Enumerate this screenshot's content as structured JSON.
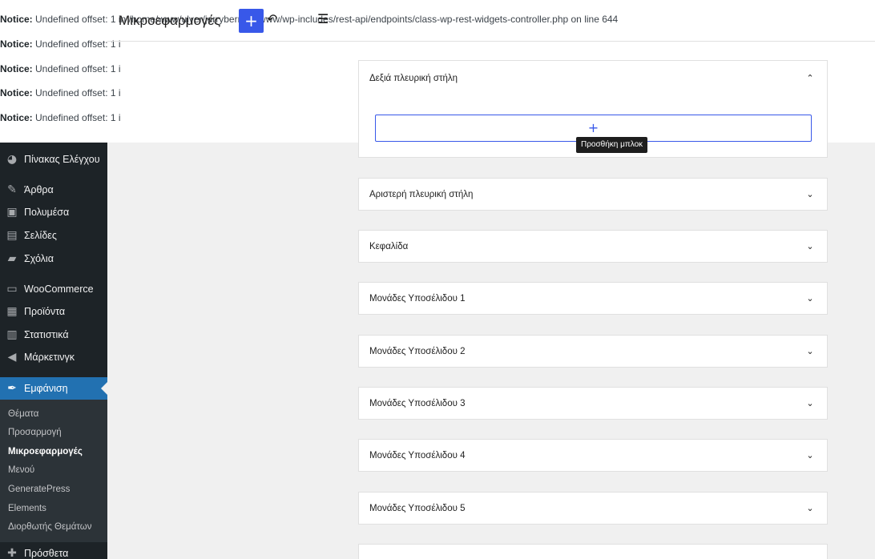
{
  "notices": {
    "label": "Notice:",
    "lines": [
      "Undefined offset: 1 in /home/www/ulver/jerryberry.gr/www/wp-includes/rest-api/endpoints/class-wp-rest-widgets-controller.php on line 644",
      "Undefined offset: 1 i",
      "Undefined offset: 1 i",
      "Undefined offset: 1 i",
      "Undefined offset: 1 i"
    ]
  },
  "header": {
    "title": "Μικροεφαρμογές",
    "inserter": "+",
    "undo_icon": "undo-icon",
    "list_icon": "list-view-icon"
  },
  "sidebar": {
    "items": [
      {
        "label": "Πίνακας Ελέγχου",
        "icon": "dashboard-icon"
      },
      {
        "label": "Άρθρα",
        "icon": "pin-icon"
      },
      {
        "label": "Πολυμέσα",
        "icon": "media-icon"
      },
      {
        "label": "Σελίδες",
        "icon": "pages-icon"
      },
      {
        "label": "Σχόλια",
        "icon": "comments-icon"
      },
      {
        "label": "WooCommerce",
        "icon": "woo-icon"
      },
      {
        "label": "Προϊόντα",
        "icon": "products-icon"
      },
      {
        "label": "Στατιστικά",
        "icon": "stats-icon"
      },
      {
        "label": "Μάρκετινγκ",
        "icon": "megaphone-icon"
      },
      {
        "label": "Εμφάνιση",
        "icon": "brush-icon"
      },
      {
        "label": "Πρόσθετα",
        "icon": "plugin-icon"
      }
    ],
    "submenu": [
      "Θέματα",
      "Προσαρμογή",
      "Μικροεφαρμογές",
      "Μενού",
      "GeneratePress",
      "Elements",
      "Διορθωτής Θεμάτων"
    ]
  },
  "widget_areas": [
    "Δεξιά πλευρική στήλη",
    "Αριστερή πλευρική στήλη",
    "Κεφαλίδα",
    "Μονάδες Υποσέλιδου 1",
    "Μονάδες Υποσέλιδου 2",
    "Μονάδες Υποσέλιδου 3",
    "Μονάδες Υποσέλιδου 4",
    "Μονάδες Υποσέλιδου 5"
  ],
  "add_block": {
    "plus": "+",
    "tooltip": "Προσθήκη μπλοκ"
  },
  "accent": "#3858e9"
}
